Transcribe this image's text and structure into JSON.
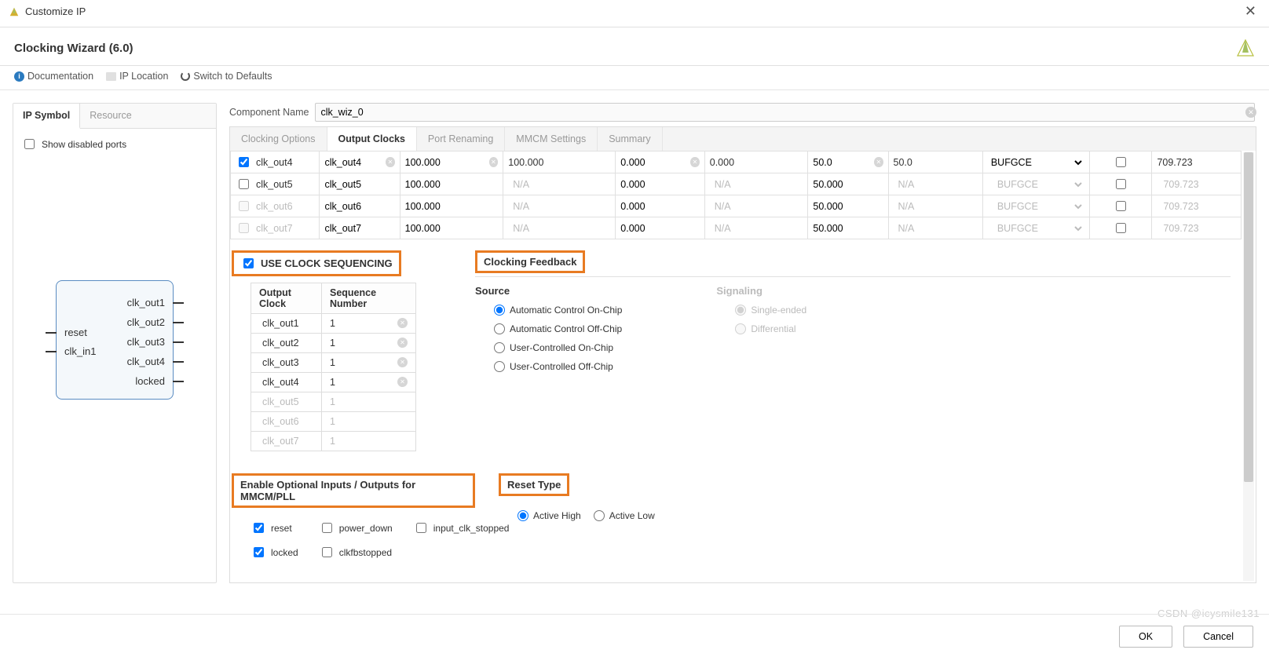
{
  "titlebar": {
    "title": "Customize IP"
  },
  "wizard": {
    "title": "Clocking Wizard (6.0)"
  },
  "links": {
    "doc": "Documentation",
    "loc": "IP Location",
    "defaults": "Switch to Defaults"
  },
  "leftTabs": {
    "ipSymbol": "IP Symbol",
    "resource": "Resource"
  },
  "leftPane": {
    "showDisabled": "Show disabled ports"
  },
  "ipBlock": {
    "left": [
      "reset",
      "clk_in1"
    ],
    "right": [
      "clk_out1",
      "clk_out2",
      "clk_out3",
      "clk_out4",
      "locked"
    ]
  },
  "componentName": {
    "label": "Component Name",
    "value": "clk_wiz_0"
  },
  "mainTabs": {
    "clockingOptions": "Clocking Options",
    "outputClocks": "Output Clocks",
    "portRenaming": "Port Renaming",
    "mmcmSettings": "MMCM Settings",
    "summary": "Summary"
  },
  "clkRows": [
    {
      "en": true,
      "name": "clk_out4",
      "port": "clk_out4",
      "freq": "100.000",
      "act": "100.000",
      "phase": "0.000",
      "aphase": "0.000",
      "duty": "50.0",
      "aduty": "50.0",
      "drv": "BUFGCE",
      "max": "709.723",
      "dis": false
    },
    {
      "en": false,
      "name": "clk_out5",
      "port": "clk_out5",
      "freq": "100.000",
      "act": "N/A",
      "phase": "0.000",
      "aphase": "N/A",
      "duty": "50.000",
      "aduty": "N/A",
      "drv": "BUFGCE",
      "max": "709.723",
      "dis": false
    },
    {
      "en": false,
      "name": "clk_out6",
      "port": "clk_out6",
      "freq": "100.000",
      "act": "N/A",
      "phase": "0.000",
      "aphase": "N/A",
      "duty": "50.000",
      "aduty": "N/A",
      "drv": "BUFGCE",
      "max": "709.723",
      "dis": true
    },
    {
      "en": false,
      "name": "clk_out7",
      "port": "clk_out7",
      "freq": "100.000",
      "act": "N/A",
      "phase": "0.000",
      "aphase": "N/A",
      "duty": "50.000",
      "aduty": "N/A",
      "drv": "BUFGCE",
      "max": "709.723",
      "dis": true
    }
  ],
  "useClockSeq": {
    "label": "USE CLOCK SEQUENCING"
  },
  "seqHeaders": {
    "clk": "Output Clock",
    "seq": "Sequence Number"
  },
  "seqRows": [
    {
      "clk": "clk_out1",
      "seq": "1",
      "dis": false
    },
    {
      "clk": "clk_out2",
      "seq": "1",
      "dis": false
    },
    {
      "clk": "clk_out3",
      "seq": "1",
      "dis": false
    },
    {
      "clk": "clk_out4",
      "seq": "1",
      "dis": false
    },
    {
      "clk": "clk_out5",
      "seq": "1",
      "dis": true
    },
    {
      "clk": "clk_out6",
      "seq": "1",
      "dis": true
    },
    {
      "clk": "clk_out7",
      "seq": "1",
      "dis": true
    }
  ],
  "feedback": {
    "title": "Clocking Feedback",
    "source": "Source",
    "signaling": "Signaling",
    "srcOptions": [
      "Automatic Control On-Chip",
      "Automatic Control Off-Chip",
      "User-Controlled On-Chip",
      "User-Controlled Off-Chip"
    ],
    "sigOptions": [
      "Single-ended",
      "Differential"
    ]
  },
  "optIO": {
    "title": "Enable Optional Inputs / Outputs for MMCM/PLL",
    "reset": "reset",
    "power_down": "power_down",
    "input_stopped": "input_clk_stopped",
    "locked": "locked",
    "clkfbstopped": "clkfbstopped"
  },
  "resetType": {
    "title": "Reset Type",
    "high": "Active High",
    "low": "Active Low"
  },
  "footer": {
    "ok": "OK",
    "cancel": "Cancel"
  },
  "watermark": "CSDN @icysmile131"
}
